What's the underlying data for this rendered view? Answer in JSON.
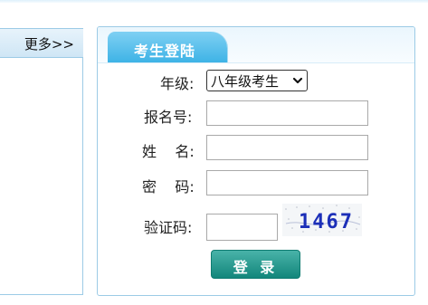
{
  "left_panel": {
    "more_link": "更多>>"
  },
  "login_panel": {
    "tab_title": "考生登陆",
    "fields": {
      "grade_label": "年级:",
      "grade_value": "八年级考生",
      "registration_label": "报名号:",
      "registration_value": "",
      "name_label": "姓    名:",
      "name_value": "",
      "password_label": "密    码:",
      "password_value": "",
      "captcha_label": "验证码:",
      "captcha_value": "",
      "captcha_text": "1467"
    },
    "login_button": "登 录"
  },
  "colors": {
    "panel_border": "#9ccbe6",
    "tab_blue": "#3eb3e6",
    "button_teal": "#12867b",
    "captcha_blue": "#1c2fb8"
  },
  "icons": {
    "select_chevron": "chevron-down-icon"
  }
}
